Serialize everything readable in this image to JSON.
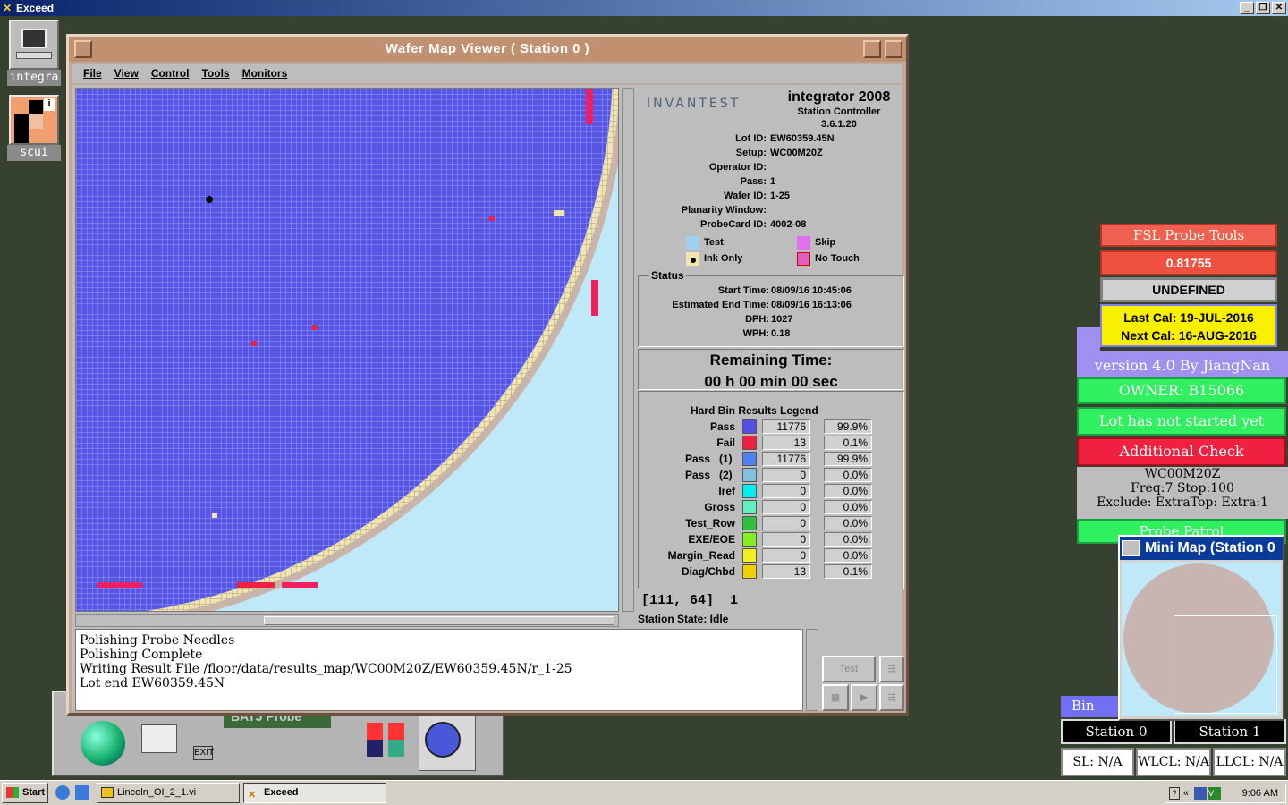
{
  "exceed": {
    "title": "Exceed"
  },
  "desktop": {
    "icons": [
      {
        "label": "integra"
      },
      {
        "label": "scui"
      }
    ]
  },
  "window": {
    "title": "Wafer Map Viewer ( Station 0 )",
    "menu": [
      "File",
      "View",
      "Control",
      "Tools",
      "Monitors"
    ]
  },
  "info": {
    "logo": "INVANTEST",
    "product": "integrator 2008",
    "subtitle": "Station Controller",
    "version": "3.6.1.20",
    "fields": [
      {
        "k": "Lot ID:",
        "v": "EW60359.45N"
      },
      {
        "k": "Setup:",
        "v": "WC00M20Z"
      },
      {
        "k": "Operator ID:",
        "v": ""
      },
      {
        "k": "Pass:",
        "v": "1"
      },
      {
        "k": "Wafer ID:",
        "v": "1-25"
      },
      {
        "k": "Planarity Window:",
        "v": ""
      },
      {
        "k": "ProbeCard ID:",
        "v": "4002-08"
      }
    ],
    "legend": [
      {
        "label": "Test",
        "color": "#9fd0f0"
      },
      {
        "label": "Skip",
        "color": "#e070f0"
      },
      {
        "label": "Ink Only",
        "color": "#f0e4b0"
      },
      {
        "label": "No Touch",
        "color": "#e060c0"
      }
    ]
  },
  "status": {
    "label": "Status",
    "fields": [
      {
        "k": "Start Time:",
        "v": "08/09/16 10:45:06"
      },
      {
        "k": "Estimated End Time:",
        "v": "08/09/16 16:13:06"
      },
      {
        "k": "DPH:",
        "v": "1027"
      },
      {
        "k": "WPH:",
        "v": "0.18"
      }
    ],
    "remaining_title": "Remaining Time:",
    "remaining_value": "00 h 00 min 00 sec"
  },
  "bins": {
    "title": "Hard Bin Results Legend",
    "rows": [
      {
        "name": "Pass",
        "num": "",
        "color": "#5050e8",
        "count": "11776",
        "pct": "99.9%"
      },
      {
        "name": "Fail",
        "num": "",
        "color": "#f02040",
        "count": "13",
        "pct": "0.1%"
      },
      {
        "name": "Pass",
        "num": "(1)",
        "color": "#5080f0",
        "count": "11776",
        "pct": "99.9%"
      },
      {
        "name": "Pass",
        "num": "(2)",
        "color": "#80c0e0",
        "count": "0",
        "pct": "0.0%"
      },
      {
        "name": "Iref",
        "num": "",
        "color": "#00f0f0",
        "count": "0",
        "pct": "0.0%"
      },
      {
        "name": "Gross",
        "num": "",
        "color": "#60f0c0",
        "count": "0",
        "pct": "0.0%"
      },
      {
        "name": "Test_Row",
        "num": "",
        "color": "#30c040",
        "count": "0",
        "pct": "0.0%"
      },
      {
        "name": "EXE/EOE",
        "num": "",
        "color": "#80f020",
        "count": "0",
        "pct": "0.0%"
      },
      {
        "name": "Margin_Read",
        "num": "",
        "color": "#f0f020",
        "count": "0",
        "pct": "0.0%"
      },
      {
        "name": "Diag/Chbd",
        "num": "",
        "color": "#f0d000",
        "count": "13",
        "pct": "0.1%"
      }
    ]
  },
  "coord": {
    "pos": "[111, 64]",
    "val": "1"
  },
  "station_state": "Station State:  Idle",
  "log": [
    "Polishing Probe Needles",
    "Polishing Complete",
    "Writing Result File /floor/data/results_map/WC00M20Z/EW60359.45N/r_1-25",
    "Lot end EW60359.45N"
  ],
  "buttons": {
    "test": "Test"
  },
  "lowpanel": {
    "label": "BATJ Probe",
    "exit": "EXIT"
  },
  "fsl": {
    "tools": "FSL Probe Tools",
    "value": "0.81755",
    "undefined": "UNDEFINED",
    "last_cal": "Last Cal: 19-JUL-2016",
    "next_cal": "Next Cal: 16-AUG-2016",
    "version": "version 4.0 By JiangNan",
    "owner": "OWNER: B15066",
    "lot_status": "Lot has not started yet",
    "additional": "Additional Check",
    "setup": "WC00M20Z",
    "freq": "Freq:7 Stop:100",
    "exclude": "Exclude: ExtraTop: Extra:1",
    "patrol": "Probe Patrol",
    "bin_tab": "Bin",
    "station0": "Station 0",
    "station1": "Station 1",
    "sl": "SL: N/A",
    "wlcl": "WLCL: N/A",
    "llcl": "LLCL: N/A"
  },
  "minimap": {
    "title": "Mini Map (Station 0"
  },
  "taskbar": {
    "start": "Start",
    "tasks": [
      "Lincoln_OI_2_1.vi",
      "Exceed"
    ],
    "time": "9:06 AM"
  }
}
